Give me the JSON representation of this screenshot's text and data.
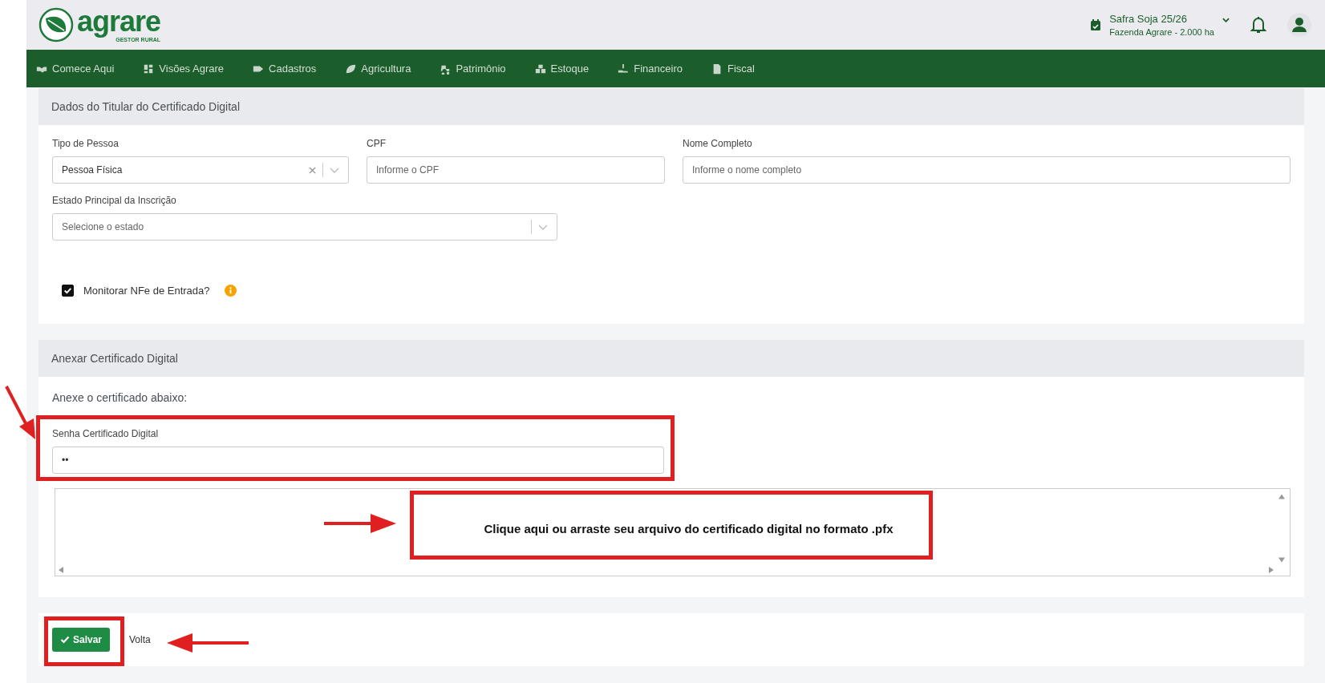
{
  "logo": {
    "name": "agrare",
    "tagline": "GESTOR RURAL"
  },
  "season": {
    "title": "Safra Soja 25/26",
    "farm": "Fazenda Agrare - 2.000 ha"
  },
  "nav": [
    {
      "label": "Comece Aqui"
    },
    {
      "label": "Visões Agrare"
    },
    {
      "label": "Cadastros"
    },
    {
      "label": "Agricultura"
    },
    {
      "label": "Patrimônio"
    },
    {
      "label": "Estoque"
    },
    {
      "label": "Financeiro"
    },
    {
      "label": "Fiscal"
    }
  ],
  "holder": {
    "title": "Dados do Titular do Certificado Digital",
    "person_type": {
      "label": "Tipo de Pessoa",
      "value": "Pessoa Física"
    },
    "cpf": {
      "label": "CPF",
      "placeholder": "Informe o CPF"
    },
    "full_name": {
      "label": "Nome Completo",
      "placeholder": "Informe o nome completo"
    },
    "state": {
      "label": "Estado Principal da Inscrição",
      "placeholder": "Selecione o estado"
    },
    "monitor": {
      "label": "Monitorar NFe de Entrada?",
      "checked": true
    }
  },
  "attach": {
    "title": "Anexar Certificado Digital",
    "subtitle": "Anexe o certificado abaixo:",
    "password": {
      "label": "Senha Certificado Digital",
      "value": "••"
    },
    "dropzone": "Clique aqui ou arraste seu arquivo do certificado digital no formato .pfx"
  },
  "actions": {
    "save": "Salvar",
    "back": "Volta"
  }
}
